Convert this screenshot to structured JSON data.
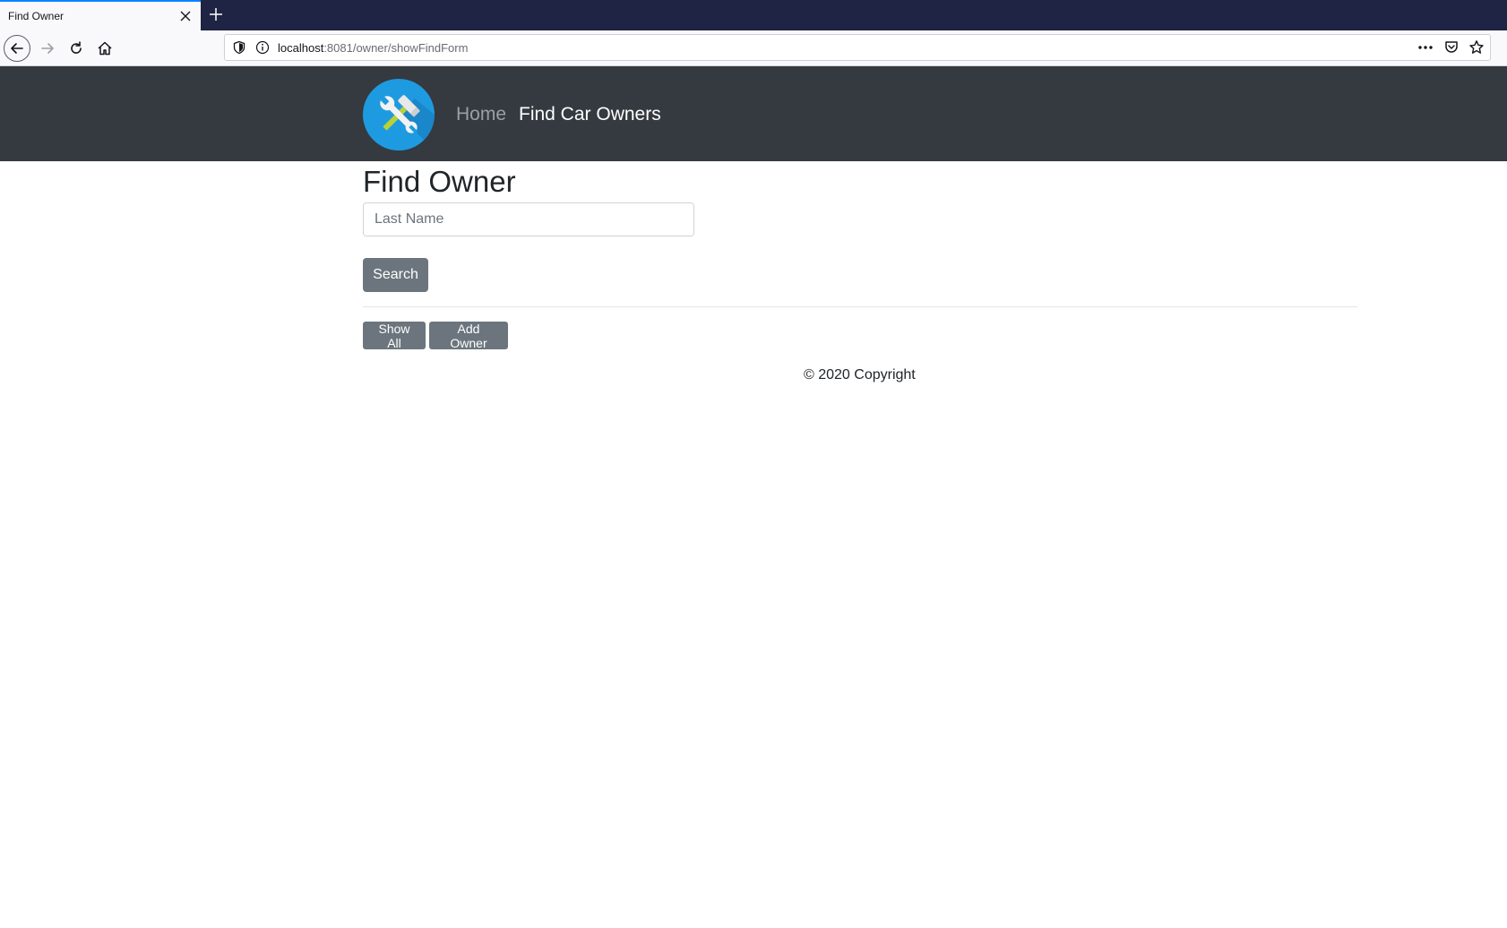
{
  "browser": {
    "tab_title": "Find Owner",
    "url_host": "localhost",
    "url_rest": ":8081/owner/showFindForm"
  },
  "header": {
    "logo_icon": "tools-icon",
    "nav_home": "Home",
    "nav_find": "Find Car Owners"
  },
  "main": {
    "title": "Find Owner",
    "search_placeholder": "Last Name",
    "search_value": "",
    "search_button": "Search",
    "show_all_button": "Show All",
    "add_owner_button": "Add Owner"
  },
  "footer": {
    "text": "© 2020 Copyright"
  },
  "colors": {
    "header_bg": "#343a40",
    "button_bg": "#6c757d",
    "logo_bg": "#1e9be0"
  }
}
